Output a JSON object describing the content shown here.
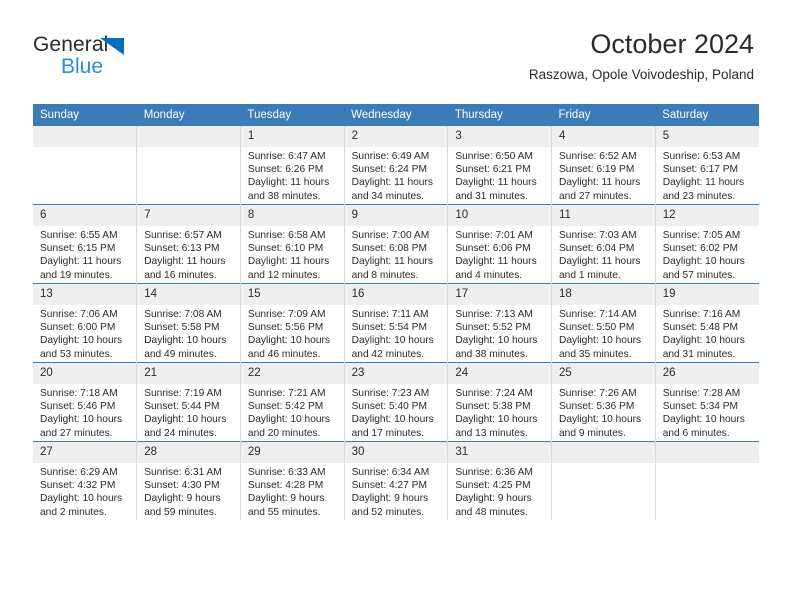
{
  "brand": {
    "name_part1": "General",
    "name_part2": "Blue",
    "triangle_icon": "triangle-icon",
    "accent_dark": "#0a6ebd",
    "accent_light": "#2a8fd8"
  },
  "header": {
    "title": "October 2024",
    "location": "Raszowa, Opole Voivodeship, Poland"
  },
  "theme": {
    "header_blue": "#3b7cb8",
    "daynum_band": "#efefef",
    "text": "#2b2b2b",
    "cell_border": "#d9d9d9"
  },
  "calendar": {
    "weekday_headers": [
      "Sunday",
      "Monday",
      "Tuesday",
      "Wednesday",
      "Thursday",
      "Friday",
      "Saturday"
    ],
    "weeks": [
      [
        {
          "day": "",
          "sunrise": "",
          "sunset": "",
          "daylight_line1": "",
          "daylight_line2": ""
        },
        {
          "day": "",
          "sunrise": "",
          "sunset": "",
          "daylight_line1": "",
          "daylight_line2": ""
        },
        {
          "day": "1",
          "sunrise": "Sunrise: 6:47 AM",
          "sunset": "Sunset: 6:26 PM",
          "daylight_line1": "Daylight: 11 hours",
          "daylight_line2": "and 38 minutes."
        },
        {
          "day": "2",
          "sunrise": "Sunrise: 6:49 AM",
          "sunset": "Sunset: 6:24 PM",
          "daylight_line1": "Daylight: 11 hours",
          "daylight_line2": "and 34 minutes."
        },
        {
          "day": "3",
          "sunrise": "Sunrise: 6:50 AM",
          "sunset": "Sunset: 6:21 PM",
          "daylight_line1": "Daylight: 11 hours",
          "daylight_line2": "and 31 minutes."
        },
        {
          "day": "4",
          "sunrise": "Sunrise: 6:52 AM",
          "sunset": "Sunset: 6:19 PM",
          "daylight_line1": "Daylight: 11 hours",
          "daylight_line2": "and 27 minutes."
        },
        {
          "day": "5",
          "sunrise": "Sunrise: 6:53 AM",
          "sunset": "Sunset: 6:17 PM",
          "daylight_line1": "Daylight: 11 hours",
          "daylight_line2": "and 23 minutes."
        }
      ],
      [
        {
          "day": "6",
          "sunrise": "Sunrise: 6:55 AM",
          "sunset": "Sunset: 6:15 PM",
          "daylight_line1": "Daylight: 11 hours",
          "daylight_line2": "and 19 minutes."
        },
        {
          "day": "7",
          "sunrise": "Sunrise: 6:57 AM",
          "sunset": "Sunset: 6:13 PM",
          "daylight_line1": "Daylight: 11 hours",
          "daylight_line2": "and 16 minutes."
        },
        {
          "day": "8",
          "sunrise": "Sunrise: 6:58 AM",
          "sunset": "Sunset: 6:10 PM",
          "daylight_line1": "Daylight: 11 hours",
          "daylight_line2": "and 12 minutes."
        },
        {
          "day": "9",
          "sunrise": "Sunrise: 7:00 AM",
          "sunset": "Sunset: 6:08 PM",
          "daylight_line1": "Daylight: 11 hours",
          "daylight_line2": "and 8 minutes."
        },
        {
          "day": "10",
          "sunrise": "Sunrise: 7:01 AM",
          "sunset": "Sunset: 6:06 PM",
          "daylight_line1": "Daylight: 11 hours",
          "daylight_line2": "and 4 minutes."
        },
        {
          "day": "11",
          "sunrise": "Sunrise: 7:03 AM",
          "sunset": "Sunset: 6:04 PM",
          "daylight_line1": "Daylight: 11 hours",
          "daylight_line2": "and 1 minute."
        },
        {
          "day": "12",
          "sunrise": "Sunrise: 7:05 AM",
          "sunset": "Sunset: 6:02 PM",
          "daylight_line1": "Daylight: 10 hours",
          "daylight_line2": "and 57 minutes."
        }
      ],
      [
        {
          "day": "13",
          "sunrise": "Sunrise: 7:06 AM",
          "sunset": "Sunset: 6:00 PM",
          "daylight_line1": "Daylight: 10 hours",
          "daylight_line2": "and 53 minutes."
        },
        {
          "day": "14",
          "sunrise": "Sunrise: 7:08 AM",
          "sunset": "Sunset: 5:58 PM",
          "daylight_line1": "Daylight: 10 hours",
          "daylight_line2": "and 49 minutes."
        },
        {
          "day": "15",
          "sunrise": "Sunrise: 7:09 AM",
          "sunset": "Sunset: 5:56 PM",
          "daylight_line1": "Daylight: 10 hours",
          "daylight_line2": "and 46 minutes."
        },
        {
          "day": "16",
          "sunrise": "Sunrise: 7:11 AM",
          "sunset": "Sunset: 5:54 PM",
          "daylight_line1": "Daylight: 10 hours",
          "daylight_line2": "and 42 minutes."
        },
        {
          "day": "17",
          "sunrise": "Sunrise: 7:13 AM",
          "sunset": "Sunset: 5:52 PM",
          "daylight_line1": "Daylight: 10 hours",
          "daylight_line2": "and 38 minutes."
        },
        {
          "day": "18",
          "sunrise": "Sunrise: 7:14 AM",
          "sunset": "Sunset: 5:50 PM",
          "daylight_line1": "Daylight: 10 hours",
          "daylight_line2": "and 35 minutes."
        },
        {
          "day": "19",
          "sunrise": "Sunrise: 7:16 AM",
          "sunset": "Sunset: 5:48 PM",
          "daylight_line1": "Daylight: 10 hours",
          "daylight_line2": "and 31 minutes."
        }
      ],
      [
        {
          "day": "20",
          "sunrise": "Sunrise: 7:18 AM",
          "sunset": "Sunset: 5:46 PM",
          "daylight_line1": "Daylight: 10 hours",
          "daylight_line2": "and 27 minutes."
        },
        {
          "day": "21",
          "sunrise": "Sunrise: 7:19 AM",
          "sunset": "Sunset: 5:44 PM",
          "daylight_line1": "Daylight: 10 hours",
          "daylight_line2": "and 24 minutes."
        },
        {
          "day": "22",
          "sunrise": "Sunrise: 7:21 AM",
          "sunset": "Sunset: 5:42 PM",
          "daylight_line1": "Daylight: 10 hours",
          "daylight_line2": "and 20 minutes."
        },
        {
          "day": "23",
          "sunrise": "Sunrise: 7:23 AM",
          "sunset": "Sunset: 5:40 PM",
          "daylight_line1": "Daylight: 10 hours",
          "daylight_line2": "and 17 minutes."
        },
        {
          "day": "24",
          "sunrise": "Sunrise: 7:24 AM",
          "sunset": "Sunset: 5:38 PM",
          "daylight_line1": "Daylight: 10 hours",
          "daylight_line2": "and 13 minutes."
        },
        {
          "day": "25",
          "sunrise": "Sunrise: 7:26 AM",
          "sunset": "Sunset: 5:36 PM",
          "daylight_line1": "Daylight: 10 hours",
          "daylight_line2": "and 9 minutes."
        },
        {
          "day": "26",
          "sunrise": "Sunrise: 7:28 AM",
          "sunset": "Sunset: 5:34 PM",
          "daylight_line1": "Daylight: 10 hours",
          "daylight_line2": "and 6 minutes."
        }
      ],
      [
        {
          "day": "27",
          "sunrise": "Sunrise: 6:29 AM",
          "sunset": "Sunset: 4:32 PM",
          "daylight_line1": "Daylight: 10 hours",
          "daylight_line2": "and 2 minutes."
        },
        {
          "day": "28",
          "sunrise": "Sunrise: 6:31 AM",
          "sunset": "Sunset: 4:30 PM",
          "daylight_line1": "Daylight: 9 hours",
          "daylight_line2": "and 59 minutes."
        },
        {
          "day": "29",
          "sunrise": "Sunrise: 6:33 AM",
          "sunset": "Sunset: 4:28 PM",
          "daylight_line1": "Daylight: 9 hours",
          "daylight_line2": "and 55 minutes."
        },
        {
          "day": "30",
          "sunrise": "Sunrise: 6:34 AM",
          "sunset": "Sunset: 4:27 PM",
          "daylight_line1": "Daylight: 9 hours",
          "daylight_line2": "and 52 minutes."
        },
        {
          "day": "31",
          "sunrise": "Sunrise: 6:36 AM",
          "sunset": "Sunset: 4:25 PM",
          "daylight_line1": "Daylight: 9 hours",
          "daylight_line2": "and 48 minutes."
        },
        {
          "day": "",
          "sunrise": "",
          "sunset": "",
          "daylight_line1": "",
          "daylight_line2": ""
        },
        {
          "day": "",
          "sunrise": "",
          "sunset": "",
          "daylight_line1": "",
          "daylight_line2": ""
        }
      ]
    ]
  }
}
